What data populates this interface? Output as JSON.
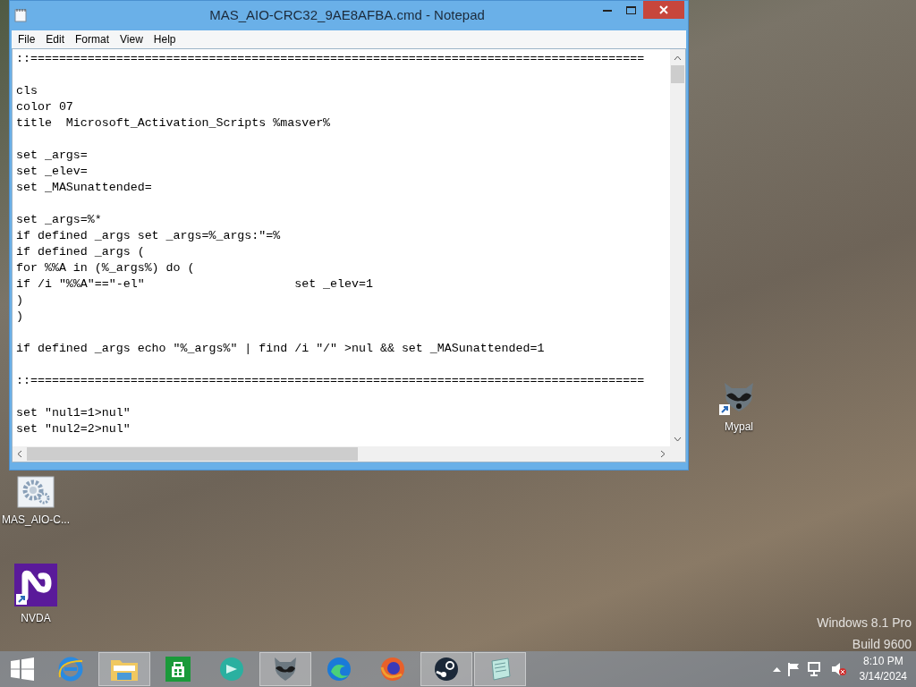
{
  "window": {
    "title": "MAS_AIO-CRC32_9AE8AFBA.cmd - Notepad",
    "menu": [
      "File",
      "Edit",
      "Format",
      "View",
      "Help"
    ],
    "text": "::======================================================================================\n\ncls\ncolor 07\ntitle  Microsoft_Activation_Scripts %masver%\n\nset _args=\nset _elev=\nset _MASunattended=\n\nset _args=%*\nif defined _args set _args=%_args:\"=%\nif defined _args (\nfor %%A in (%_args%) do (\nif /i \"%%A\"==\"-el\"                     set _elev=1\n)\n)\n\nif defined _args echo \"%_args%\" | find /i \"/\" >nul && set _MASunattended=1\n\n::======================================================================================\n\nset \"nul1=1>nul\"\nset \"nul2=2>nul\""
  },
  "desktop_icons": [
    {
      "kind": "gear",
      "label": "MAS_AIO-C..."
    },
    {
      "kind": "nvda",
      "label": "NVDA"
    },
    {
      "kind": "raccoon",
      "label": "Mypal"
    }
  ],
  "watermark": [
    "Windows 8.1 Pro",
    "Build 9600"
  ],
  "taskbar": {
    "apps": [
      {
        "kind": "ie",
        "running": false
      },
      {
        "kind": "explorer",
        "running": true
      },
      {
        "kind": "store",
        "running": false
      },
      {
        "kind": "teal",
        "running": false
      },
      {
        "kind": "raccoon",
        "running": true
      },
      {
        "kind": "edge",
        "running": false
      },
      {
        "kind": "firefox",
        "running": false
      },
      {
        "kind": "steam",
        "running": true
      },
      {
        "kind": "notepad",
        "running": true
      }
    ],
    "time": "8:10 PM",
    "date": "3/14/2024"
  }
}
